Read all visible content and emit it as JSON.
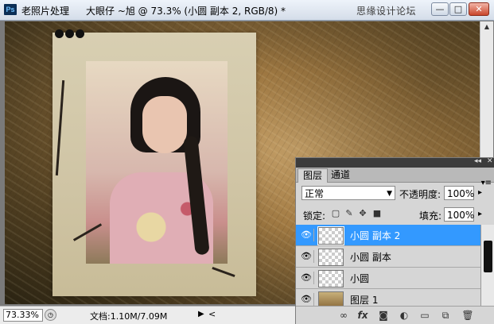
{
  "window": {
    "app_icon": "Ps",
    "app_name": "老照片处理",
    "doc_title": "大眼仔 ~旭 @ 73.3% (小圆 副本 2, RGB/8) *",
    "watermark": "思缘设计论坛",
    "buttons": {
      "minimize": "—",
      "maximize": "□",
      "close": "✕"
    }
  },
  "canvas": {
    "zoom_percent": 73.3
  },
  "status_bar": {
    "zoom": "73.33%",
    "doc_info": "文档:1.10M/7.09M",
    "arrow": "▶",
    "scroll_left": "<"
  },
  "layers_panel": {
    "collapse": "◂◂",
    "close": "✕",
    "tabs": [
      {
        "label": "图层",
        "active": true
      },
      {
        "label": "通道",
        "active": false
      }
    ],
    "menu": "▾≡",
    "blend_mode": "正常",
    "opacity_label": "不透明度:",
    "opacity": "100%",
    "lock_label": "锁定:",
    "fill_label": "填充:",
    "fill": "100%",
    "layers": [
      {
        "name": "小圆 副本 2",
        "visible": true,
        "selected": true
      },
      {
        "name": "小圆 副本",
        "visible": true,
        "selected": false
      },
      {
        "name": "小圆",
        "visible": true,
        "selected": false
      },
      {
        "name": "图层 1",
        "visible": true,
        "selected": false
      }
    ],
    "footer_icons": [
      "link-icon",
      "fx-icon",
      "mask-icon",
      "adjustment-icon",
      "group-icon",
      "new-layer-icon",
      "trash-icon"
    ]
  },
  "colors": {
    "selection": "#3399ff",
    "panel_bg": "#d6d6d6"
  }
}
